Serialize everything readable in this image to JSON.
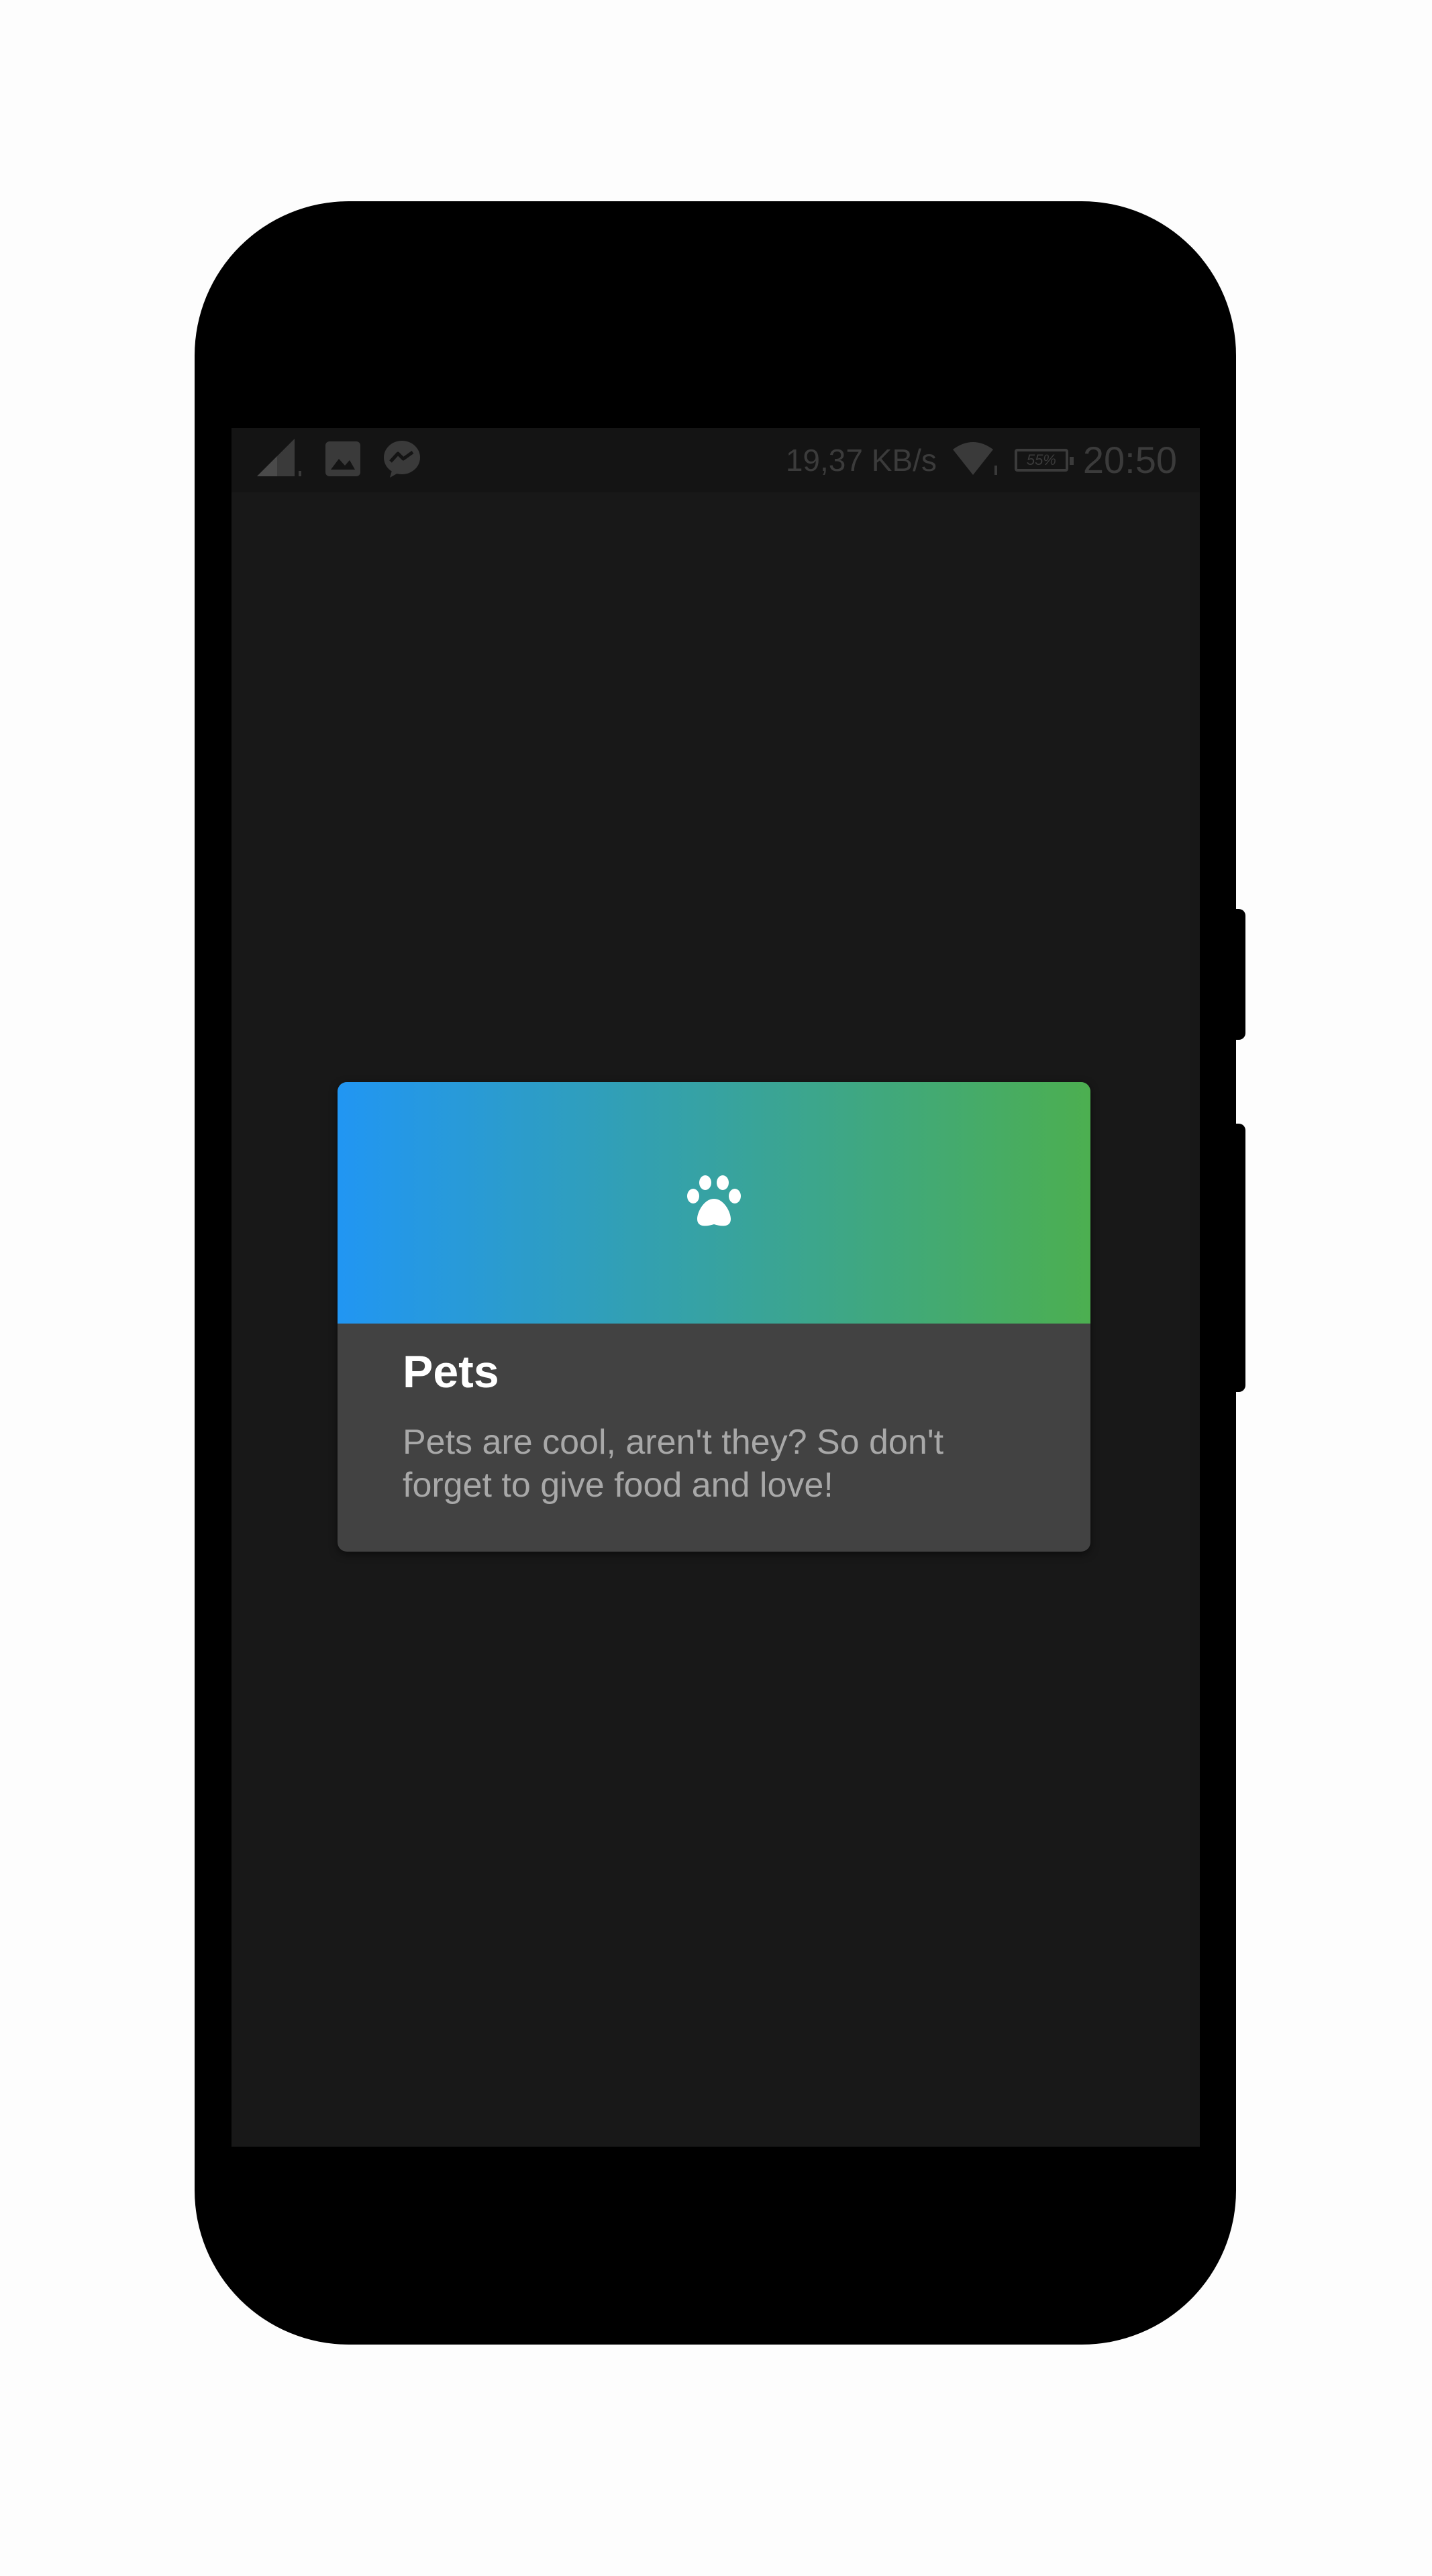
{
  "statusbar": {
    "icons_left": [
      "signal-icon",
      "image-icon",
      "messenger-icon"
    ],
    "net_speed": "19,37  KB/s",
    "battery_level": "55%",
    "time": "20:50"
  },
  "card": {
    "icon": "paw-icon",
    "title": "Pets",
    "description": "Pets are cool, aren't they? So don't forget to give food and love!",
    "gradient_start": "#2196f3",
    "gradient_end": "#4caf50"
  },
  "colors": {
    "screen_bg": "#181818",
    "card_bg": "#424242"
  }
}
